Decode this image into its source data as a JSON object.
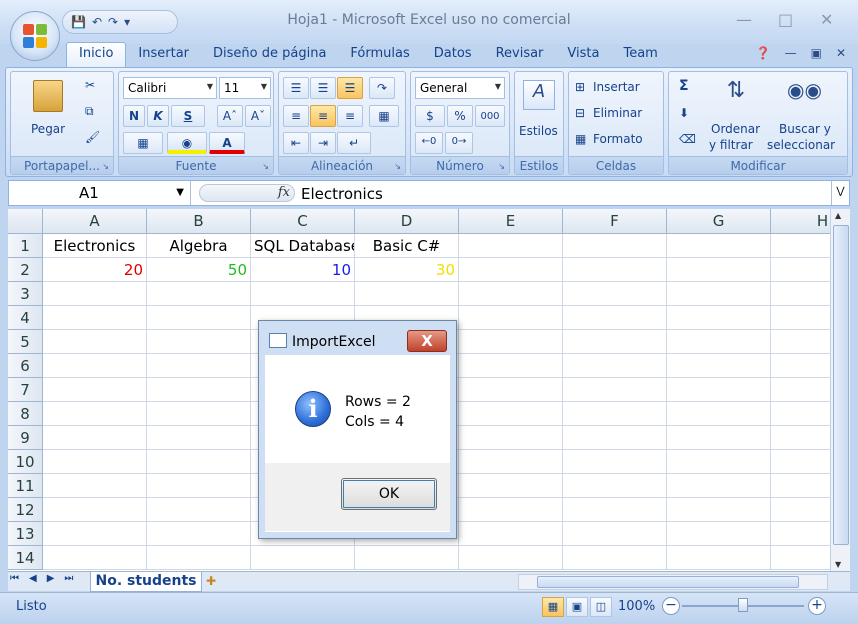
{
  "window": {
    "title": "Hoja1 - Microsoft Excel uso no comercial"
  },
  "ribbon": {
    "tabs": [
      "Inicio",
      "Insertar",
      "Diseño de página",
      "Fórmulas",
      "Datos",
      "Revisar",
      "Vista",
      "Team"
    ],
    "active_tab": "Inicio",
    "groups": {
      "portapapeles": {
        "label": "Portapapel...",
        "paste": "Pegar"
      },
      "fuente": {
        "label": "Fuente",
        "font": "Calibri",
        "size": "11",
        "bold": "N",
        "italic": "K",
        "underline": "S"
      },
      "alineacion": {
        "label": "Alineación"
      },
      "numero": {
        "label": "Número",
        "format": "General",
        "currency": "$",
        "percent": "%",
        "thousands": "000"
      },
      "estilos": {
        "label": "Estilos",
        "button": "Estilos"
      },
      "celdas": {
        "label": "Celdas",
        "insert": "Insertar",
        "delete": "Eliminar",
        "format": "Formato"
      },
      "modificar": {
        "label": "Modificar",
        "sort_line1": "Ordenar",
        "sort_line2": "y filtrar",
        "find_line1": "Buscar y",
        "find_line2": "seleccionar",
        "sigma": "Σ"
      }
    }
  },
  "formula_bar": {
    "name_box": "A1",
    "fx": "fx",
    "value": "Electronics"
  },
  "sheet": {
    "columns": [
      "A",
      "B",
      "C",
      "D",
      "E",
      "F",
      "G",
      "H"
    ],
    "rows": [
      {
        "n": "1",
        "cells": [
          "Electronics",
          "Algebra",
          "SQL Databases",
          "Basic C#",
          "",
          "",
          "",
          ""
        ]
      },
      {
        "n": "2",
        "cells": [
          "20",
          "50",
          "10",
          "30",
          "",
          "",
          "",
          ""
        ]
      },
      {
        "n": "3",
        "cells": [
          "",
          "",
          "",
          "",
          "",
          "",
          "",
          ""
        ]
      },
      {
        "n": "4",
        "cells": [
          "",
          "",
          "",
          "",
          "",
          "",
          "",
          ""
        ]
      },
      {
        "n": "5",
        "cells": [
          "",
          "",
          "",
          "",
          "",
          "",
          "",
          ""
        ]
      },
      {
        "n": "6",
        "cells": [
          "",
          "",
          "",
          "",
          "",
          "",
          "",
          ""
        ]
      },
      {
        "n": "7",
        "cells": [
          "",
          "",
          "",
          "",
          "",
          "",
          "",
          ""
        ]
      },
      {
        "n": "8",
        "cells": [
          "",
          "",
          "",
          "",
          "",
          "",
          "",
          ""
        ]
      },
      {
        "n": "9",
        "cells": [
          "",
          "",
          "",
          "",
          "",
          "",
          "",
          ""
        ]
      },
      {
        "n": "10",
        "cells": [
          "",
          "",
          "",
          "",
          "",
          "",
          "",
          ""
        ]
      },
      {
        "n": "11",
        "cells": [
          "",
          "",
          "",
          "",
          "",
          "",
          "",
          ""
        ]
      },
      {
        "n": "12",
        "cells": [
          "",
          "",
          "",
          "",
          "",
          "",
          "",
          ""
        ]
      },
      {
        "n": "13",
        "cells": [
          "",
          "",
          "",
          "",
          "",
          "",
          "",
          ""
        ]
      },
      {
        "n": "14",
        "cells": [
          "",
          "",
          "",
          "",
          "",
          "",
          "",
          ""
        ]
      }
    ],
    "value_colors": [
      "#e00000",
      "#22bb22",
      "#1a1aee",
      "#f0e000"
    ],
    "tab_name": "No. students"
  },
  "status": {
    "text": "Listo",
    "zoom": "100%"
  },
  "dialog": {
    "title": "ImportExcel",
    "close": "X",
    "line1": "Rows = 2",
    "line2": "Cols = 4",
    "ok": "OK",
    "icon": "info-icon"
  }
}
